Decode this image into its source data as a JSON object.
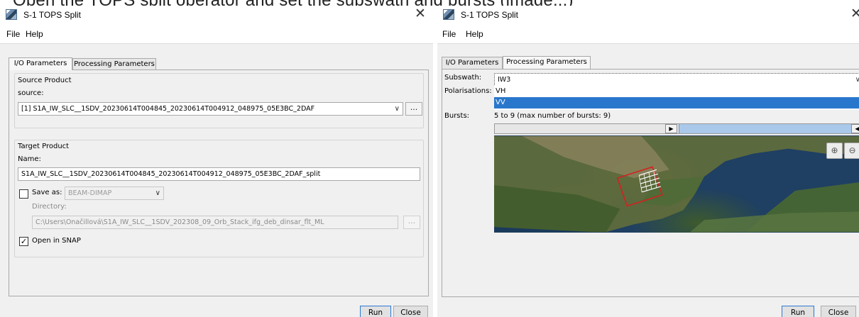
{
  "top_caption": "Open the TOPS split operator and set the subswath and bursts (image...)",
  "window_left": {
    "title": "S-1 TOPS Split",
    "menu": [
      "File",
      "Help"
    ],
    "tabs": [
      "I/O Parameters",
      "Processing Parameters"
    ],
    "source_group": {
      "title": "Source Product",
      "label": "source:",
      "value": "[1] S1A_IW_SLC__1SDV_20230614T004845_20230614T004912_048975_05E3BC_2DAF",
      "browse": "..."
    },
    "target_group": {
      "title": "Target Product",
      "name_label": "Name:",
      "name_value": "S1A_IW_SLC__1SDV_20230614T004845_20230614T004912_048975_05E3BC_2DAF_split",
      "save_as_label": "Save as:",
      "save_as_checked": false,
      "format_value": "BEAM-DIMAP",
      "directory_label": "Directory:",
      "directory_value": "C:\\Users\\Onačillová\\S1A_IW_SLC__1SDV_202308_09_Orb_Stack_ifg_deb_dinsar_flt_ML",
      "browse": "...",
      "open_in_snap_label": "Open in SNAP",
      "open_in_snap_checked": true
    },
    "buttons": {
      "run": "Run",
      "close": "Close"
    }
  },
  "window_right": {
    "title": "S-1 TOPS Split",
    "menu": [
      "File",
      "Help"
    ],
    "tabs": [
      "I/O Parameters",
      "Processing Parameters"
    ],
    "subswath_label": "Subswath:",
    "subswath_value": "IW3",
    "polarisations_label": "Polarisations:",
    "polarisations": [
      "VH",
      "VV"
    ],
    "selected_polarisation": "VV",
    "bursts_label": "Bursts:",
    "bursts_text": "5 to 9 (max number of bursts: 9)",
    "burst_range": {
      "from": 5,
      "to": 9,
      "max": 9
    },
    "buttons": {
      "run": "Run",
      "close": "Close"
    }
  },
  "icons": {
    "app": "snap-app-icon",
    "close": "close-icon",
    "dropdown": "chevron-down-icon",
    "zoom_in": "zoom-in-icon",
    "zoom_out": "zoom-out-icon"
  },
  "colors": {
    "selection": "#2977cc",
    "range_fill": "#a9c8ea",
    "footprint": "#d42020",
    "primary_border": "#2a78d4"
  }
}
